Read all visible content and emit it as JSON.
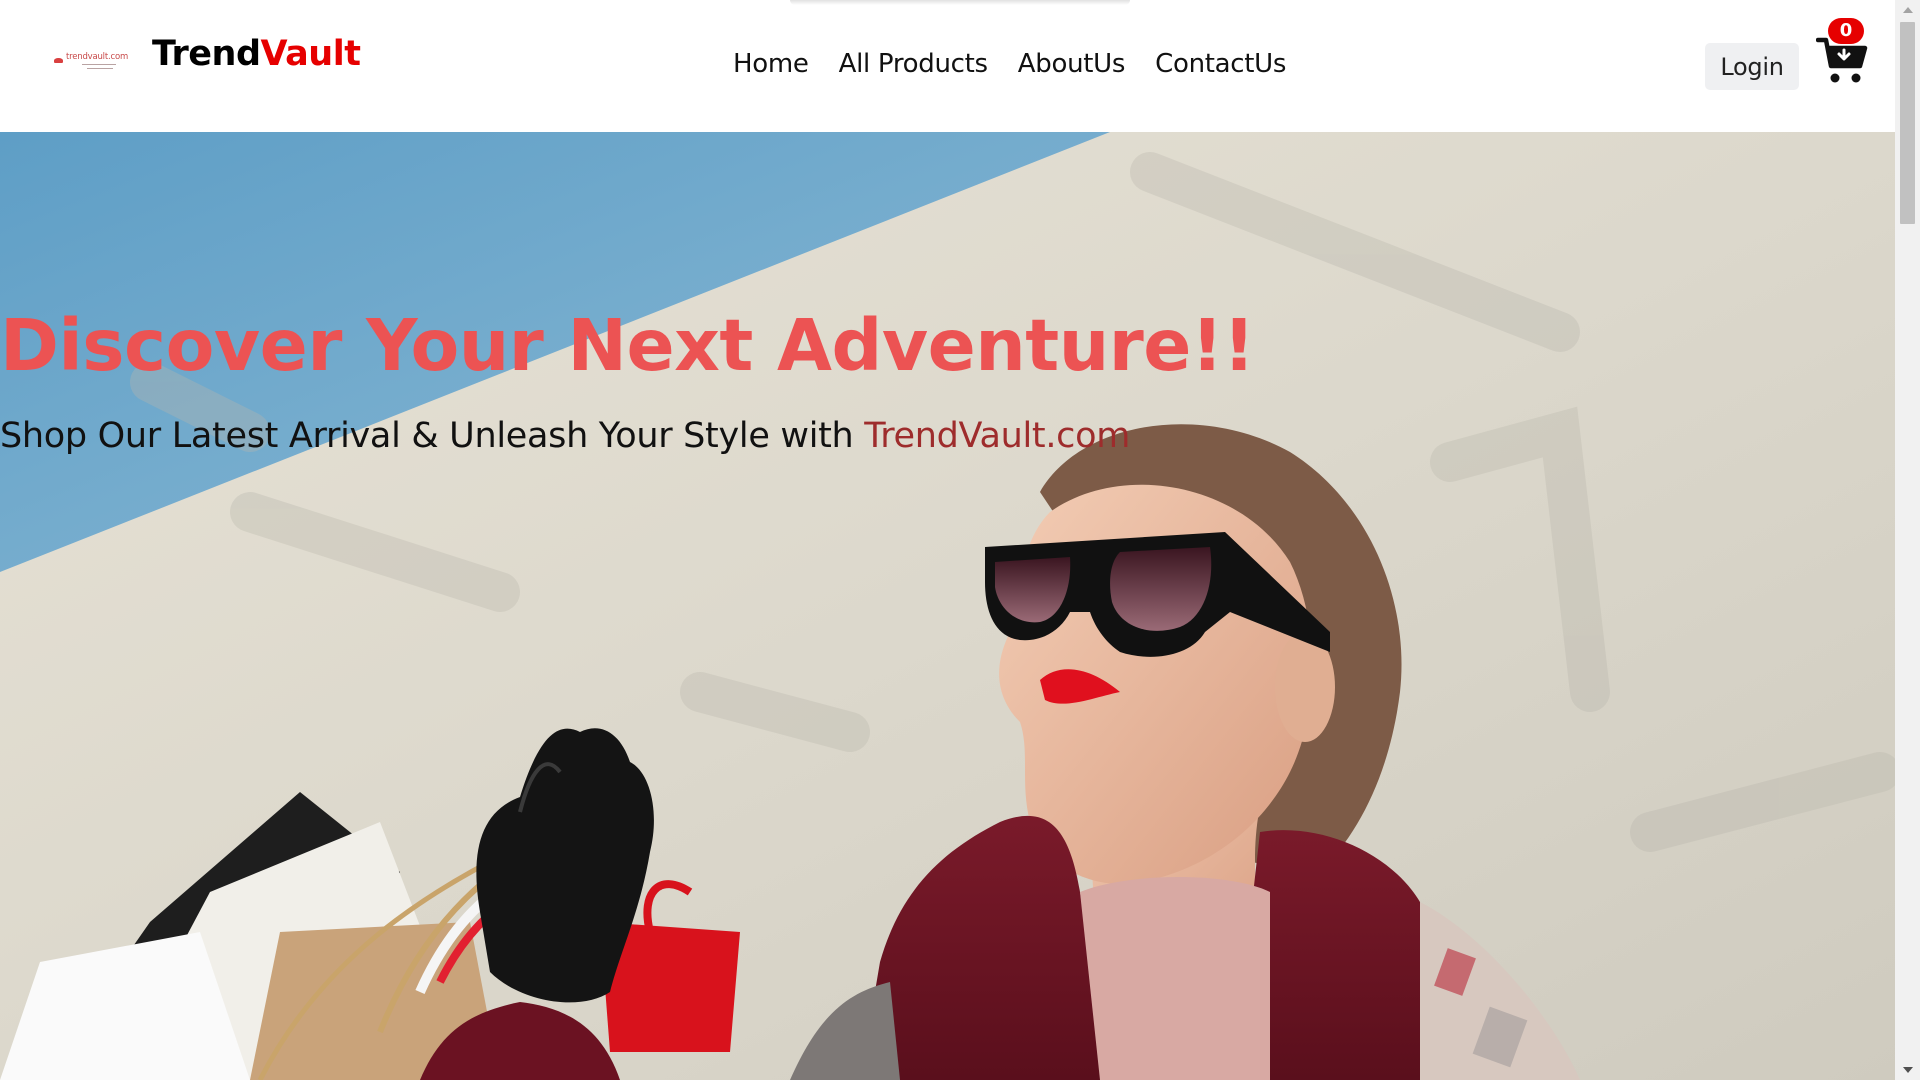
{
  "header": {
    "logo_text": "trendvault.com",
    "brand_part1": "Trend",
    "brand_part2": "Vault",
    "nav": [
      {
        "label": "Home"
      },
      {
        "label": "All Products"
      },
      {
        "label": "AboutUs"
      },
      {
        "label": "ContactUs"
      }
    ],
    "login_label": "Login",
    "cart_count": "0",
    "cart_icon": "shopping-cart-icon"
  },
  "hero": {
    "title": "Discover Your Next Adventure!!",
    "subtitle_prefix": "Shop Our Latest Arrival & Unleash Your Style with ",
    "subtitle_accent": "TrendVault.com",
    "image": "woman-with-sunglasses-holding-shopping-bags"
  },
  "colors": {
    "brand_red": "#e60000",
    "title_coral": "#ec5353",
    "accent_dark_red": "#9e2c2c"
  }
}
